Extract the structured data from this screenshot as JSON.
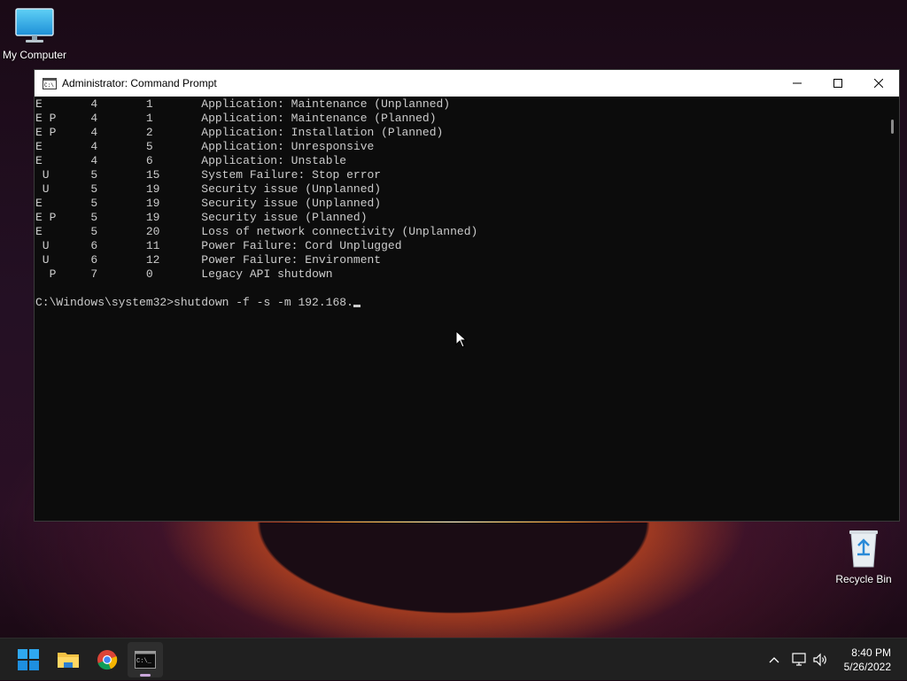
{
  "desktop": {
    "icons": [
      {
        "label": "My Computer",
        "icon": "monitor-icon"
      },
      {
        "label": "Recycle Bin",
        "icon": "recycle-bin-icon"
      }
    ]
  },
  "window": {
    "title": "Administrator: Command Prompt",
    "icon": "command-prompt-icon",
    "controls": {
      "minimize": "minimize-icon",
      "maximize": "maximize-icon",
      "close": "close-icon"
    }
  },
  "console": {
    "rows": [
      {
        "flags": "E",
        "major": "4",
        "minor": "1",
        "title": "Application: Maintenance (Unplanned)"
      },
      {
        "flags": "E P",
        "major": "4",
        "minor": "1",
        "title": "Application: Maintenance (Planned)"
      },
      {
        "flags": "E P",
        "major": "4",
        "minor": "2",
        "title": "Application: Installation (Planned)"
      },
      {
        "flags": "E",
        "major": "4",
        "minor": "5",
        "title": "Application: Unresponsive"
      },
      {
        "flags": "E",
        "major": "4",
        "minor": "6",
        "title": "Application: Unstable"
      },
      {
        "flags": " U",
        "major": "5",
        "minor": "15",
        "title": "System Failure: Stop error"
      },
      {
        "flags": " U",
        "major": "5",
        "minor": "19",
        "title": "Security issue (Unplanned)"
      },
      {
        "flags": "E",
        "major": "5",
        "minor": "19",
        "title": "Security issue (Unplanned)"
      },
      {
        "flags": "E P",
        "major": "5",
        "minor": "19",
        "title": "Security issue (Planned)"
      },
      {
        "flags": "E",
        "major": "5",
        "minor": "20",
        "title": "Loss of network connectivity (Unplanned)"
      },
      {
        "flags": " U",
        "major": "6",
        "minor": "11",
        "title": "Power Failure: Cord Unplugged"
      },
      {
        "flags": " U",
        "major": "6",
        "minor": "12",
        "title": "Power Failure: Environment"
      },
      {
        "flags": "  P",
        "major": "7",
        "minor": "0",
        "title": "Legacy API shutdown"
      }
    ],
    "prompt": "C:\\Windows\\system32>",
    "command": "shutdown -f -s -m 192.168."
  },
  "taskbar": {
    "apps": [
      {
        "name": "Start",
        "icon": "windows-start-icon"
      },
      {
        "name": "File Explorer",
        "icon": "folder-icon"
      },
      {
        "name": "Google Chrome",
        "icon": "chrome-icon"
      },
      {
        "name": "Command Prompt",
        "icon": "command-prompt-icon",
        "active": true
      }
    ],
    "tray": {
      "chevron": "chevron-up-icon",
      "network": "network-icon",
      "volume": "volume-icon"
    },
    "time": "8:40 PM",
    "date": "5/26/2022"
  }
}
